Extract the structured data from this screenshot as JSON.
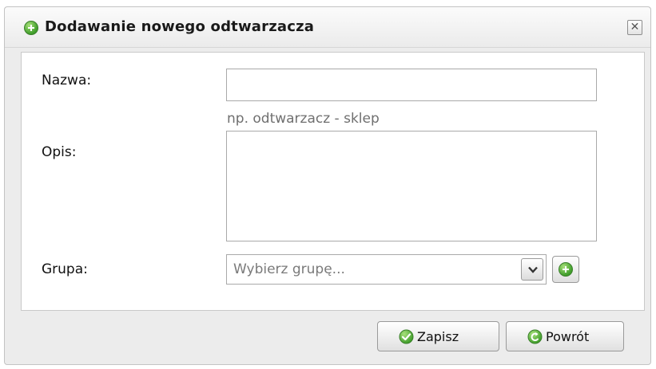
{
  "dialog": {
    "title": "Dodawanie nowego odtwarzacza",
    "close_symbol": "✕"
  },
  "form": {
    "name_label": "Nazwa:",
    "name_value": "",
    "name_hint": "np. odtwarzacz - sklep",
    "description_label": "Opis:",
    "description_value": "",
    "group_label": "Grupa:",
    "group_placeholder": "Wybierz grupę..."
  },
  "buttons": {
    "save_label": "Zapisz",
    "back_label": "Powrót"
  },
  "icons": {
    "title": "add-circle-icon",
    "close": "close-icon",
    "dropdown": "chevron-down-icon",
    "add_group": "add-circle-icon",
    "save": "check-circle-icon",
    "back": "return-arrow-icon"
  },
  "colors": {
    "accent_green": "#3f9d2a",
    "hint_text": "#6f6f6f",
    "window_background": "#ececec"
  }
}
